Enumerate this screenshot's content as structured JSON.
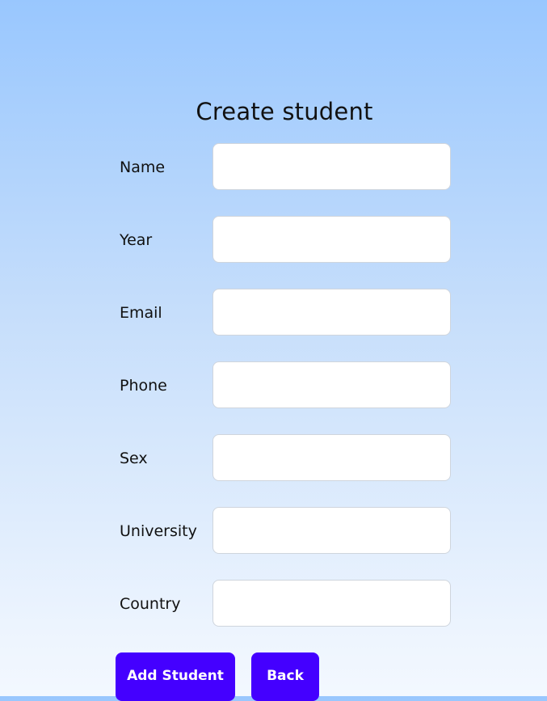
{
  "page": {
    "title": "Create student"
  },
  "form": {
    "fields": [
      {
        "label": "Name",
        "value": "",
        "placeholder": ""
      },
      {
        "label": "Year",
        "value": "",
        "placeholder": ""
      },
      {
        "label": "Email",
        "value": "",
        "placeholder": ""
      },
      {
        "label": "Phone",
        "value": "",
        "placeholder": ""
      },
      {
        "label": "Sex",
        "value": "",
        "placeholder": ""
      },
      {
        "label": "University",
        "value": "",
        "placeholder": ""
      },
      {
        "label": "Country",
        "value": "",
        "placeholder": ""
      }
    ],
    "add_label": "Add Student",
    "back_label": "Back"
  },
  "colors": {
    "background_top": "#99c7fe",
    "background_bottom": "#f3f8ff",
    "button": "#4400ff",
    "button_text": "#ffffff",
    "input_border": "#cfd5dd"
  }
}
